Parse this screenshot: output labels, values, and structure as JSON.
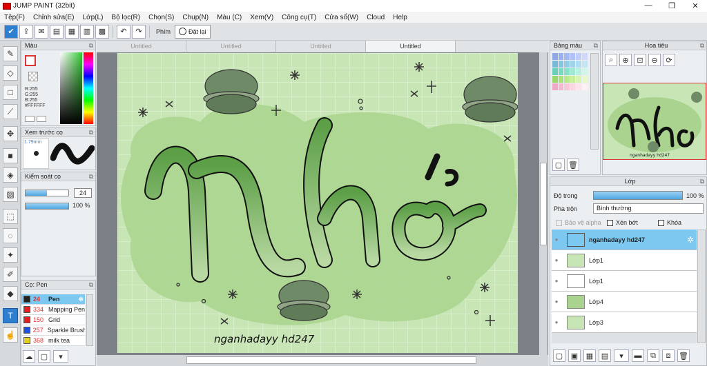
{
  "window": {
    "title": "JUMP PAINT (32bit)",
    "min": "—",
    "max": "❐",
    "close": "✕"
  },
  "menu": [
    "Tệp(F)",
    "Chỉnh sửa(E)",
    "Lớp(L)",
    "Bộ lọc(R)",
    "Chọn(S)",
    "Chụp(N)",
    "Màu (C)",
    "Xem(V)",
    "Công cụ(T)",
    "Cửa sổ(W)",
    "Cloud",
    "Help"
  ],
  "toolbar": {
    "keys_label": "Phím",
    "reset_label": "Đặt lại"
  },
  "tabs": [
    "Untitled",
    "Untitled",
    "Untitled",
    "Untitled"
  ],
  "color_panel": {
    "title": "Màu",
    "r": "R:255",
    "g": "G:255",
    "b": "B:255",
    "hex": "#FFFFFF"
  },
  "preview_panel": {
    "title": "Xem trước cọ",
    "size": "1.79mm"
  },
  "brush_control": {
    "title": "Kiểm soát cọ",
    "size_value": "24",
    "opacity_value": "100 %",
    "size_fraction": 0.5,
    "opacity_fraction": 1.0
  },
  "brush_list": {
    "title": "Cọ: Pen",
    "items": [
      {
        "size": "24",
        "name": "Pen",
        "color": "#222222"
      },
      {
        "size": "334",
        "name": "Mapping Pen",
        "color": "#e02020"
      },
      {
        "size": "150",
        "name": "Grid",
        "color": "#e02020"
      },
      {
        "size": "257",
        "name": "Sparkle Brush",
        "color": "#2050e0"
      },
      {
        "size": "368",
        "name": "milk tea",
        "color": "#e0d020"
      }
    ]
  },
  "swatch_panel": {
    "title": "Bảng màu"
  },
  "navigator_panel": {
    "title": "Hoa tiêu"
  },
  "layer_panel": {
    "title": "Lớp",
    "opacity_label": "Độ trong",
    "opacity_value": "100 %",
    "blend_label": "Pha trộn",
    "blend_value": "Bình thường",
    "protect_alpha": "Bảo vệ alpha",
    "clip": "Xén bớt",
    "lock": "Khóa",
    "layers": [
      {
        "name": "nganhadayy hd247",
        "selected": true
      },
      {
        "name": "Lớp1",
        "selected": false
      },
      {
        "name": "Lớp1",
        "selected": false
      },
      {
        "name": "Lớp4",
        "selected": false
      },
      {
        "name": "Lớp3",
        "selected": false
      }
    ]
  },
  "artwork": {
    "text": "Nhớ",
    "signature": "nganhadayy hd247",
    "nav_signature": "nganhadayy hd247"
  },
  "colors": {
    "accent": "#2f7fd0",
    "selected_layer": "#7dc8f0",
    "canvas_green": "#c8e6b5",
    "blob_green": "#a9d38e",
    "letter_green": "#6aab52"
  }
}
